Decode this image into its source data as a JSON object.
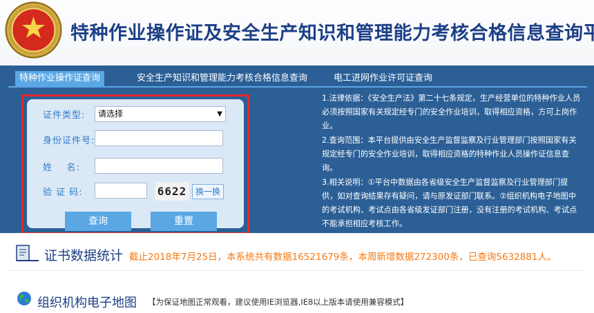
{
  "header": {
    "title": "特种作业操作证及安全生产知识和管理能力考核合格信息查询平台",
    "emblem_icon": "national-emblem-icon"
  },
  "tabs": [
    {
      "label": "特种作业操作证查询",
      "active": true
    },
    {
      "label": "安全生产知识和管理能力考核合格信息查询",
      "active": false
    },
    {
      "label": "电工进网作业许可证查询",
      "active": false
    }
  ],
  "form": {
    "cert_type_label": "证件类型:",
    "cert_type_value": "请选择",
    "id_label": "身份证件号:",
    "id_value": "",
    "name_label": "姓    名:",
    "name_value": "",
    "code_label": "验 证 码:",
    "code_value": "",
    "captcha_text": "6622",
    "refresh_label": "换一换",
    "query_label": "查询",
    "reset_label": "重置"
  },
  "info": {
    "p1": "1.法律依据：《安全生产法》第二十七条规定，生产经营单位的特种作业人员必须按照国家有关规定经专门的安全作业培训，取得相应资格，方可上岗作业。",
    "p2": "2.查询范围：本平台提供由安全生产监督监察及行业管理部门按照国家有关规定经专门的安全作业培训，取得相应资格的特种作业人员操作证信息查询。",
    "p3": "3.相关说明：①平台中数据由各省级安全生产监督监察及行业管理部门提供，如对查询结果存有疑问，请与原发证部门联系。②组织机构电子地图中的考试机构、考试点由各省级发证部门注册，没有注册的考试机构、考试点不能承担相应考核工作。"
  },
  "stats": {
    "heading": "证书数据统计",
    "text": "截止2018年7月25日，本系统共有数据16521679条，本周新增数据272300条，已查询5632881人。"
  },
  "map": {
    "heading": "组织机构电子地图",
    "note": "【为保证地图正常观看，建议使用IE浏览器,IE8以上版本请使用兼容模式】"
  },
  "colors": {
    "panel_blue": "#2b5f96",
    "accent_blue": "#5aa7e4",
    "title_blue": "#1d3f86",
    "stats_orange": "#f47a16",
    "highlight_red": "#e8252c"
  }
}
